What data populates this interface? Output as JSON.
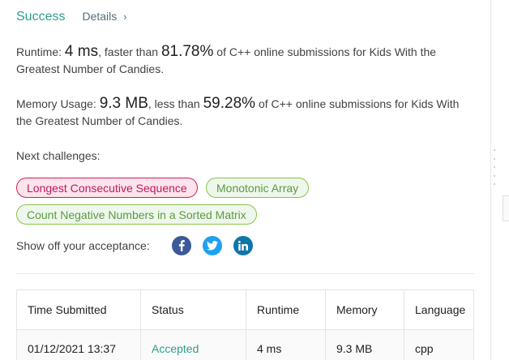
{
  "header": {
    "status": "Success",
    "details_label": "Details",
    "details_chevron": "›"
  },
  "runtime": {
    "label": "Runtime: ",
    "value": "4 ms",
    "middle": ", faster than ",
    "percent": "81.78%",
    "tail": " of C++ online submissions for Kids With the Greatest Number of Candies."
  },
  "memory": {
    "label": "Memory Usage: ",
    "value": "9.3 MB",
    "middle": ", less than ",
    "percent": "59.28%",
    "tail": " of C++ online submissions for Kids With the Greatest Number of Candies."
  },
  "next": {
    "label": "Next challenges:",
    "challenges": [
      {
        "title": "Longest Consecutive Sequence",
        "difficulty": "hard",
        "color": "#d81b60"
      },
      {
        "title": "Monotonic Array",
        "difficulty": "easy",
        "color": "#8bc34a"
      },
      {
        "title": "Count Negative Numbers in a Sorted Matrix",
        "difficulty": "easy",
        "color": "#8bc34a"
      }
    ]
  },
  "share": {
    "label": "Show off your acceptance:",
    "icons": [
      "facebook-icon",
      "twitter-icon",
      "linkedin-icon"
    ],
    "colors": {
      "facebook": "#3b5998",
      "twitter": "#1da1f2",
      "linkedin": "#0e76a8"
    }
  },
  "submissions": {
    "columns": [
      "Time Submitted",
      "Status",
      "Runtime",
      "Memory",
      "Language"
    ],
    "rows": [
      {
        "time": "01/12/2021 13:37",
        "status": "Accepted",
        "runtime": "4 ms",
        "memory": "9.3 MB",
        "language": "cpp"
      }
    ]
  },
  "colors": {
    "accent": "#2e9e8a",
    "text": "#424242"
  }
}
